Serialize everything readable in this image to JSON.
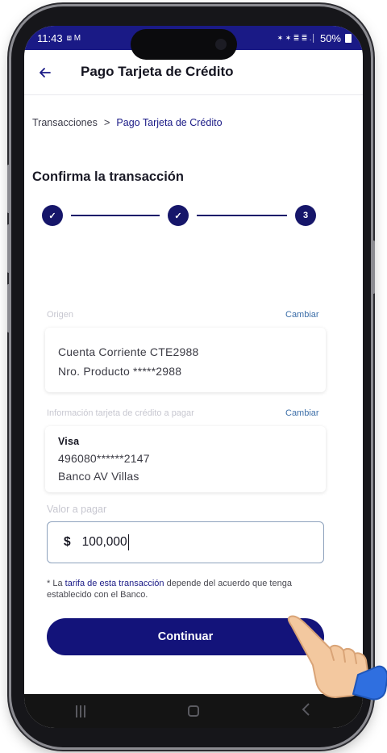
{
  "status_bar": {
    "time": "11:43",
    "left_icons": "⧈ M",
    "right_icons": "✶ ✶ ≣ ≣ .│",
    "battery": "50%"
  },
  "header": {
    "title": "Pago Tarjeta de Crédito"
  },
  "breadcrumb": {
    "root": "Transacciones",
    "separator": ">",
    "current": "Pago Tarjeta de Crédito"
  },
  "page": {
    "section_title": "Confirma la transacción"
  },
  "stepper": {
    "steps": [
      {
        "state": "done",
        "label": "✓"
      },
      {
        "state": "done",
        "label": "✓"
      },
      {
        "state": "current",
        "label": "3"
      }
    ]
  },
  "origin": {
    "label": "Origen",
    "change_label": "Cambiar",
    "account_name": "Cuenta Corriente CTE2988",
    "product_number": "Nro. Producto *****2988"
  },
  "card_to_pay": {
    "label": "Información tarjeta de crédito a pagar",
    "change_label": "Cambiar",
    "brand": "Visa",
    "number": "496080******2147",
    "bank": "Banco AV Villas"
  },
  "amount": {
    "label": "Valor a pagar",
    "currency": "$",
    "value": "100,000"
  },
  "disclaimer": {
    "prefix": "* La ",
    "link_text": "tarifa de esta transacción",
    "suffix": " depende del acuerdo que tenga establecido con el Banco."
  },
  "actions": {
    "continue_label": "Continuar"
  },
  "colors": {
    "brand_navy": "#13137a",
    "status_bar": "#1a1a86",
    "link_blue": "#3c6ea8",
    "hand_skin": "#f3c89f",
    "cuff_blue": "#2f6fe0"
  }
}
